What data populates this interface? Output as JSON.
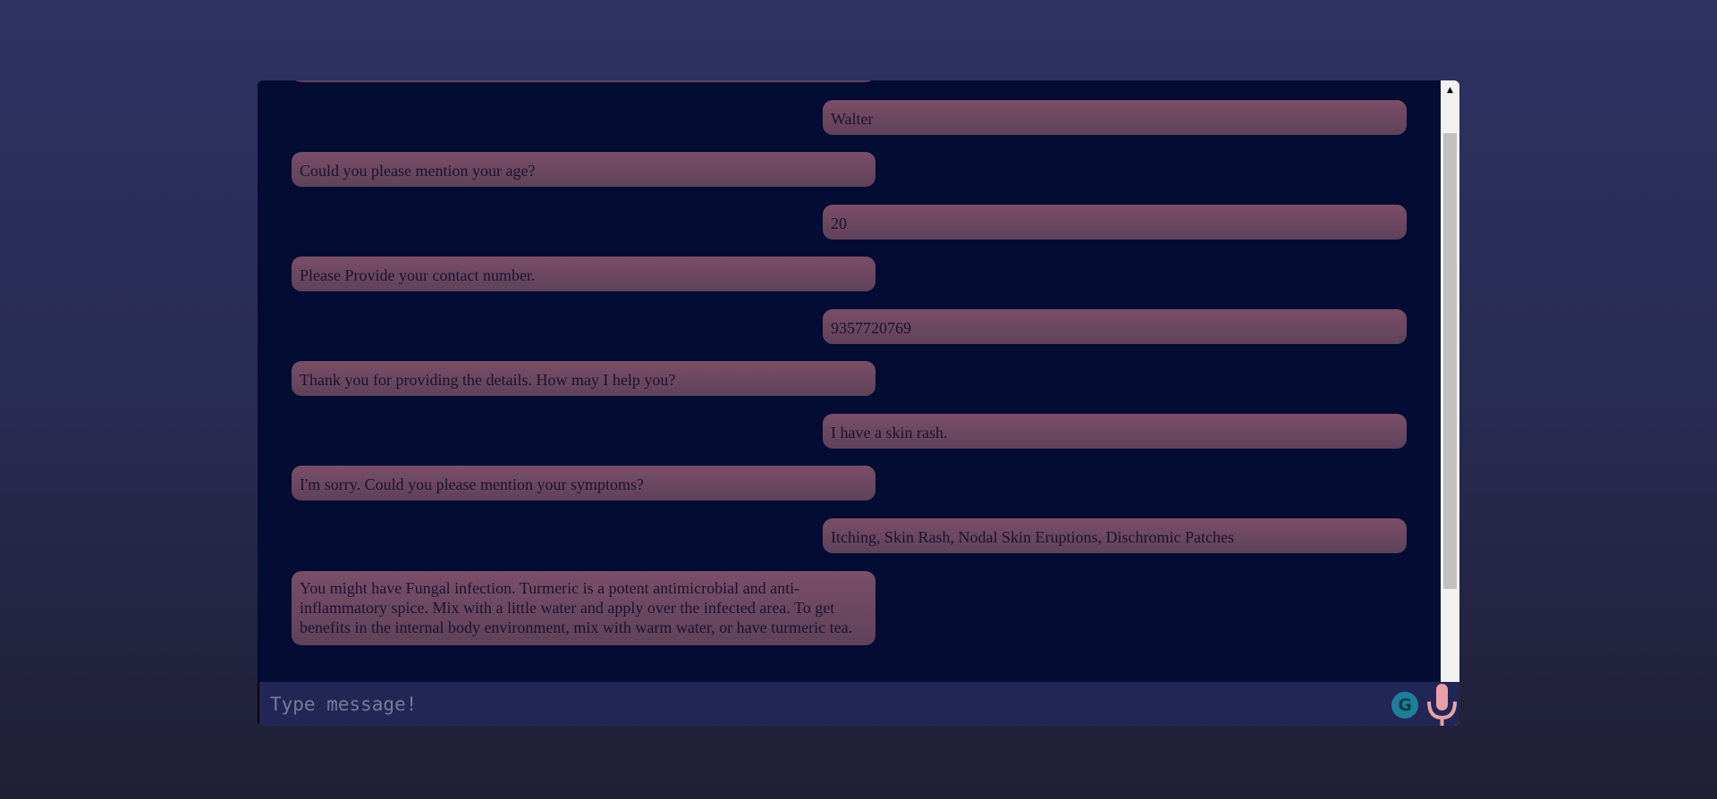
{
  "chat": {
    "messages": [
      {
        "sender": "bot",
        "text": ""
      },
      {
        "sender": "user",
        "text": "Walter"
      },
      {
        "sender": "bot",
        "text": "Could you please mention your age?"
      },
      {
        "sender": "user",
        "text": "20"
      },
      {
        "sender": "bot",
        "text": "Please Provide your contact number."
      },
      {
        "sender": "user",
        "text": "9357720769"
      },
      {
        "sender": "bot",
        "text": "Thank you for providing the details. How may I help you?"
      },
      {
        "sender": "user",
        "text": "I have a skin rash."
      },
      {
        "sender": "bot",
        "text": "I'm sorry. Could you please mention your symptoms?"
      },
      {
        "sender": "user",
        "text": "Itching, Skin Rash, Nodal Skin Eruptions, Dischromic Patches"
      },
      {
        "sender": "bot",
        "text": "You might have Fungal infection. Turmeric is a potent antimicrobial and anti-inflammatory spice. Mix with a little water and apply over the infected area. To get benefits in the internal body environment, mix with warm water, or have turmeric tea."
      }
    ]
  },
  "input": {
    "placeholder": "Type message!",
    "value": ""
  },
  "icons": {
    "grammarly": "grammarly-icon",
    "microphone": "microphone-icon",
    "scroll_up": "scroll-up-arrow-icon"
  },
  "colors": {
    "background_top": "#2e3262",
    "chat_background": "#030c33",
    "bubble": "#7b4e68",
    "input_bar": "#222654",
    "mic": "#e8a0a8"
  }
}
